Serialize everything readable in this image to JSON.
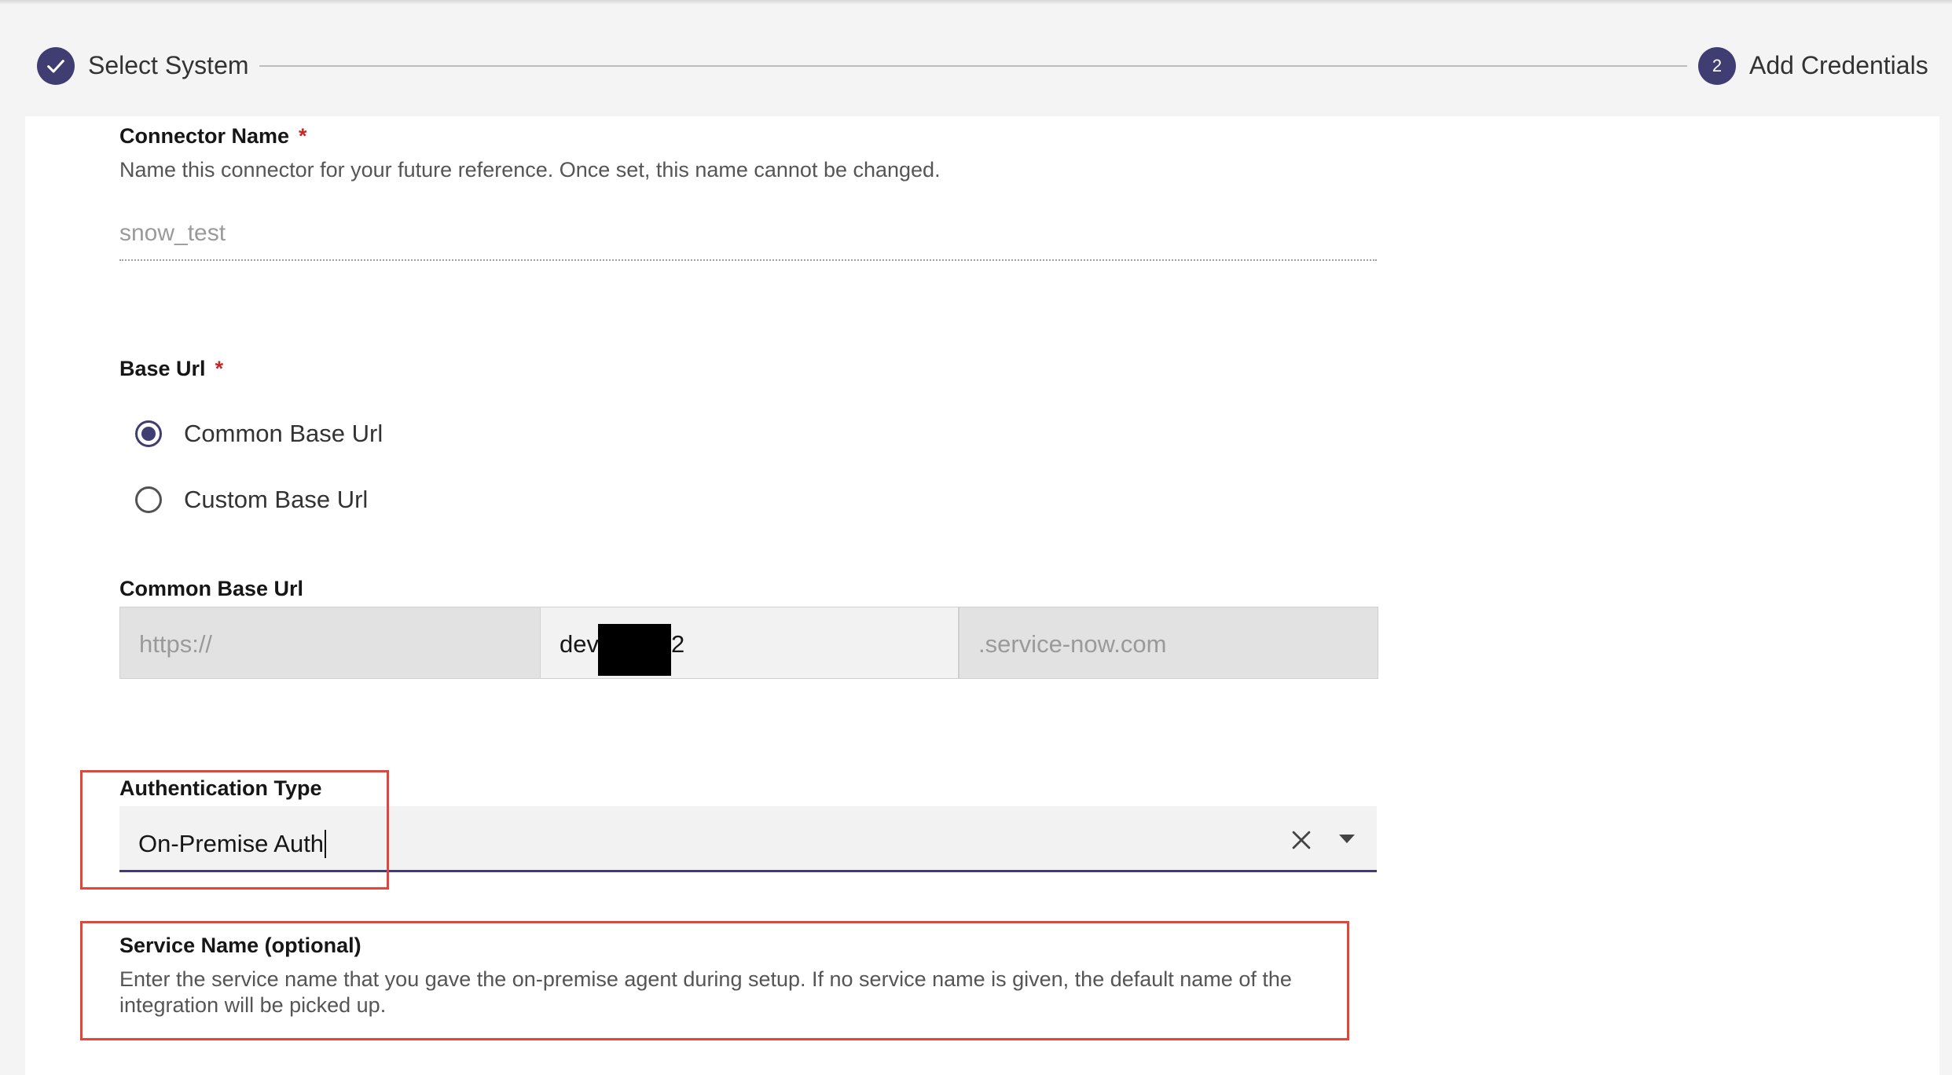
{
  "stepper": {
    "step1": {
      "label": "Select System",
      "state": "complete"
    },
    "step2": {
      "number": "2",
      "label": "Add Credentials",
      "state": "active"
    }
  },
  "connector_name": {
    "label": "Connector Name",
    "required_mark": "*",
    "helper": "Name this connector for your future reference. Once set, this name cannot be changed.",
    "value": "snow_test"
  },
  "base_url": {
    "label": "Base Url",
    "required_mark": "*",
    "options": [
      {
        "label": "Common Base Url",
        "selected": true
      },
      {
        "label": "Custom Base Url",
        "selected": false
      }
    ]
  },
  "common_base_url": {
    "label": "Common Base Url",
    "prefix": "https://",
    "instance_start": "dev",
    "instance_end": "2",
    "suffix": ".service-now.com"
  },
  "authentication_type": {
    "label": "Authentication Type",
    "value": "On-Premise Auth"
  },
  "service_name": {
    "label": "Service Name (optional)",
    "helper": "Enter the service name that you gave the on-premise agent during setup. If no service name is given, the default name of the integration will be picked up."
  },
  "colors": {
    "accent": "#3f3d72",
    "required": "#c62828",
    "highlight": "#e0463c"
  }
}
